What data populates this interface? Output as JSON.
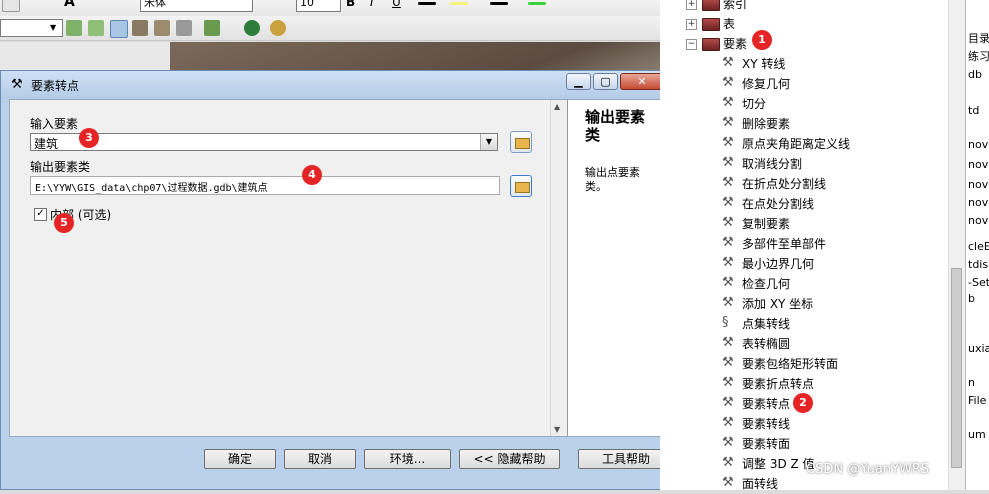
{
  "toolbar": {
    "font_value": "宋体",
    "size_value": "10",
    "bold": "B",
    "italic": "I",
    "underline": "U",
    "font_color": "A"
  },
  "dialog": {
    "title": "要素转点",
    "input_label": "输入要素",
    "input_value": "建筑",
    "output_label": "输出要素类",
    "output_value": "E:\\YYW\\GIS_data\\chp07\\过程数据.gdb\\建筑点",
    "inside_label": "内部 (可选)",
    "inside_checked": "✓",
    "help_title": "输出要素类",
    "help_text": "输出点要素类。",
    "buttons": {
      "ok": "确定",
      "cancel": "取消",
      "env": "环境...",
      "hide_help": "<< 隐藏帮助",
      "tool_help": "工具帮助"
    }
  },
  "badges": {
    "b1": "1",
    "b2": "2",
    "b3": "3",
    "b4": "4",
    "b5": "5"
  },
  "tree": {
    "top_items": [
      {
        "label": "索引",
        "expander": "+"
      },
      {
        "label": "表",
        "expander": "+"
      },
      {
        "label": "要素",
        "expander": "−"
      }
    ],
    "tools": [
      "XY 转线",
      "修复几何",
      "切分",
      "删除要素",
      "原点夹角距离定义线",
      "取消线分割",
      "在折点处分割线",
      "在点处分割线",
      "复制要素",
      "多部件至单部件",
      "最小边界几何",
      "检查几何",
      "添加 XY 坐标",
      "点集转线",
      "表转椭圆",
      "要素包络矩形转面",
      "要素折点转点",
      "要素转点",
      "要素转线",
      "要素转面",
      "调整 3D Z 值",
      "面转线"
    ]
  },
  "right_strip": [
    "目录",
    "练习",
    "db",
    "td",
    "nov",
    "nov",
    "nov",
    "nov",
    "nov",
    "cleE",
    "tdis",
    "-Set",
    "b",
    "uxia",
    "n",
    "File",
    "um"
  ],
  "watermark": "CSDN @YuanYWRS",
  "colors": {
    "badge": "#e52525",
    "title_bar": "#b9d1ea",
    "close": "#c64a33"
  }
}
